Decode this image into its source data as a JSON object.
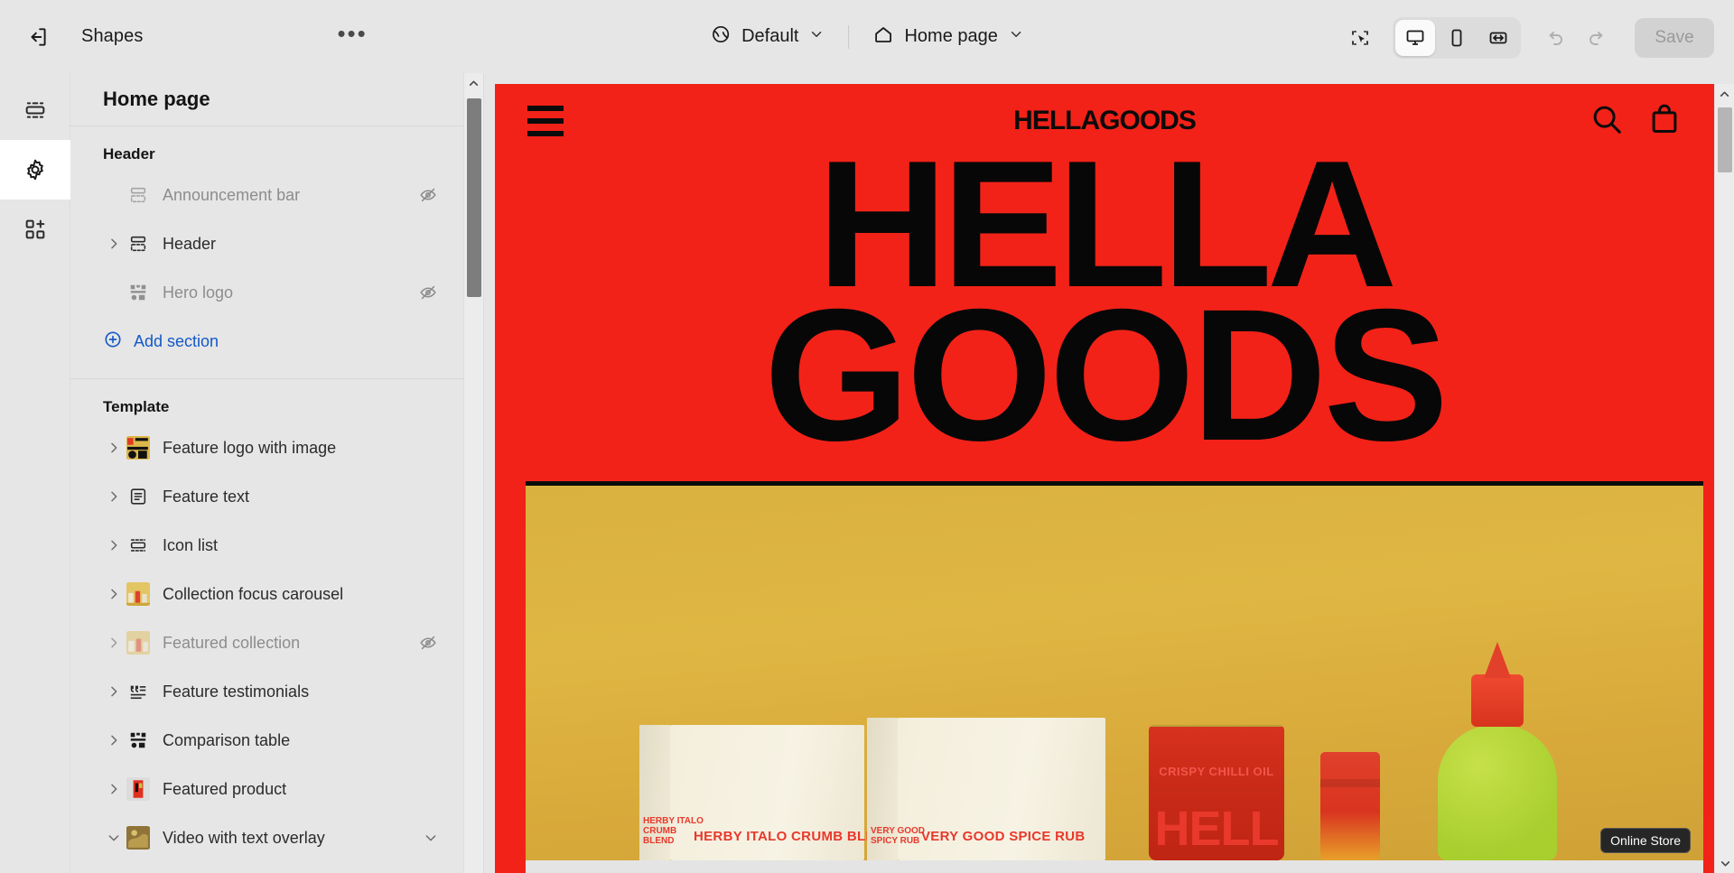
{
  "topbar": {
    "exit_icon": "exit-icon",
    "title": "Shapes",
    "more_label": "•••",
    "theme": {
      "icon": "globe-icon",
      "label": "Default",
      "caret": "chevron-down-icon"
    },
    "page": {
      "icon": "home-icon",
      "label": "Home page",
      "caret": "chevron-down-icon"
    },
    "tools": {
      "inspect": "select-cursor-icon",
      "desktop": "desktop-icon",
      "mobile": "mobile-icon",
      "fullwidth": "fullwidth-icon",
      "undo": "undo-icon",
      "redo": "redo-icon"
    },
    "save_label": "Save"
  },
  "rail": {
    "items": [
      {
        "name": "sections-icon",
        "active": false
      },
      {
        "name": "settings-gear-icon",
        "active": true
      },
      {
        "name": "apps-add-icon",
        "active": false
      }
    ]
  },
  "panel": {
    "title": "Home page",
    "groups": [
      {
        "label": "Header",
        "rows": [
          {
            "label": "Announcement bar",
            "icon": "section-bar-icon",
            "expandable": false,
            "hidden": true
          },
          {
            "label": "Header",
            "icon": "section-bar-icon",
            "expandable": true,
            "hidden": false
          },
          {
            "label": "Hero logo",
            "icon": "logo-grid-icon",
            "expandable": false,
            "hidden": true
          }
        ],
        "add_label": "Add section"
      },
      {
        "label": "Template",
        "rows": [
          {
            "label": "Feature logo with image",
            "icon": "thumb-feature-logo",
            "expandable": true,
            "hidden": false
          },
          {
            "label": "Feature text",
            "icon": "text-block-icon",
            "expandable": true,
            "hidden": false
          },
          {
            "label": "Icon list",
            "icon": "icon-list-icon",
            "expandable": true,
            "hidden": false
          },
          {
            "label": "Collection focus carousel",
            "icon": "thumb-carousel",
            "expandable": true,
            "hidden": false
          },
          {
            "label": "Featured collection",
            "icon": "thumb-collection",
            "expandable": true,
            "hidden": true
          },
          {
            "label": "Feature testimonials",
            "icon": "quote-list-icon",
            "expandable": true,
            "hidden": false
          },
          {
            "label": "Comparison table",
            "icon": "comparison-table-icon",
            "expandable": true,
            "hidden": false
          },
          {
            "label": "Featured product",
            "icon": "thumb-product",
            "expandable": true,
            "hidden": false
          },
          {
            "label": "Video with text overlay",
            "icon": "thumb-video",
            "expandable": true,
            "expanded": true,
            "hidden": false
          }
        ]
      }
    ]
  },
  "preview": {
    "store": {
      "logo": "HELLAGOODS",
      "menu_icon": "hamburger-menu-icon",
      "search_icon": "search-icon",
      "cart_icon": "shopping-bag-icon"
    },
    "hero": {
      "line1": "HELLA",
      "line2": "GOODS"
    },
    "products": [
      {
        "name": "HERBY ITALO CRUMB BLEND",
        "side": "HERBY ITALO CRUMB BLEND"
      },
      {
        "name": "VERY GOOD SPICE RUB",
        "side": "VERY GOOD SPICY RUB"
      },
      {
        "name": "CRISPY CHILLI OIL",
        "brand": "HELL"
      }
    ],
    "tooltip": "Online Store"
  },
  "colors": {
    "brand_red": "#f22218",
    "gold": "#d9b13f",
    "link_blue": "#1358c8",
    "chrome": "#e6e6e6"
  }
}
